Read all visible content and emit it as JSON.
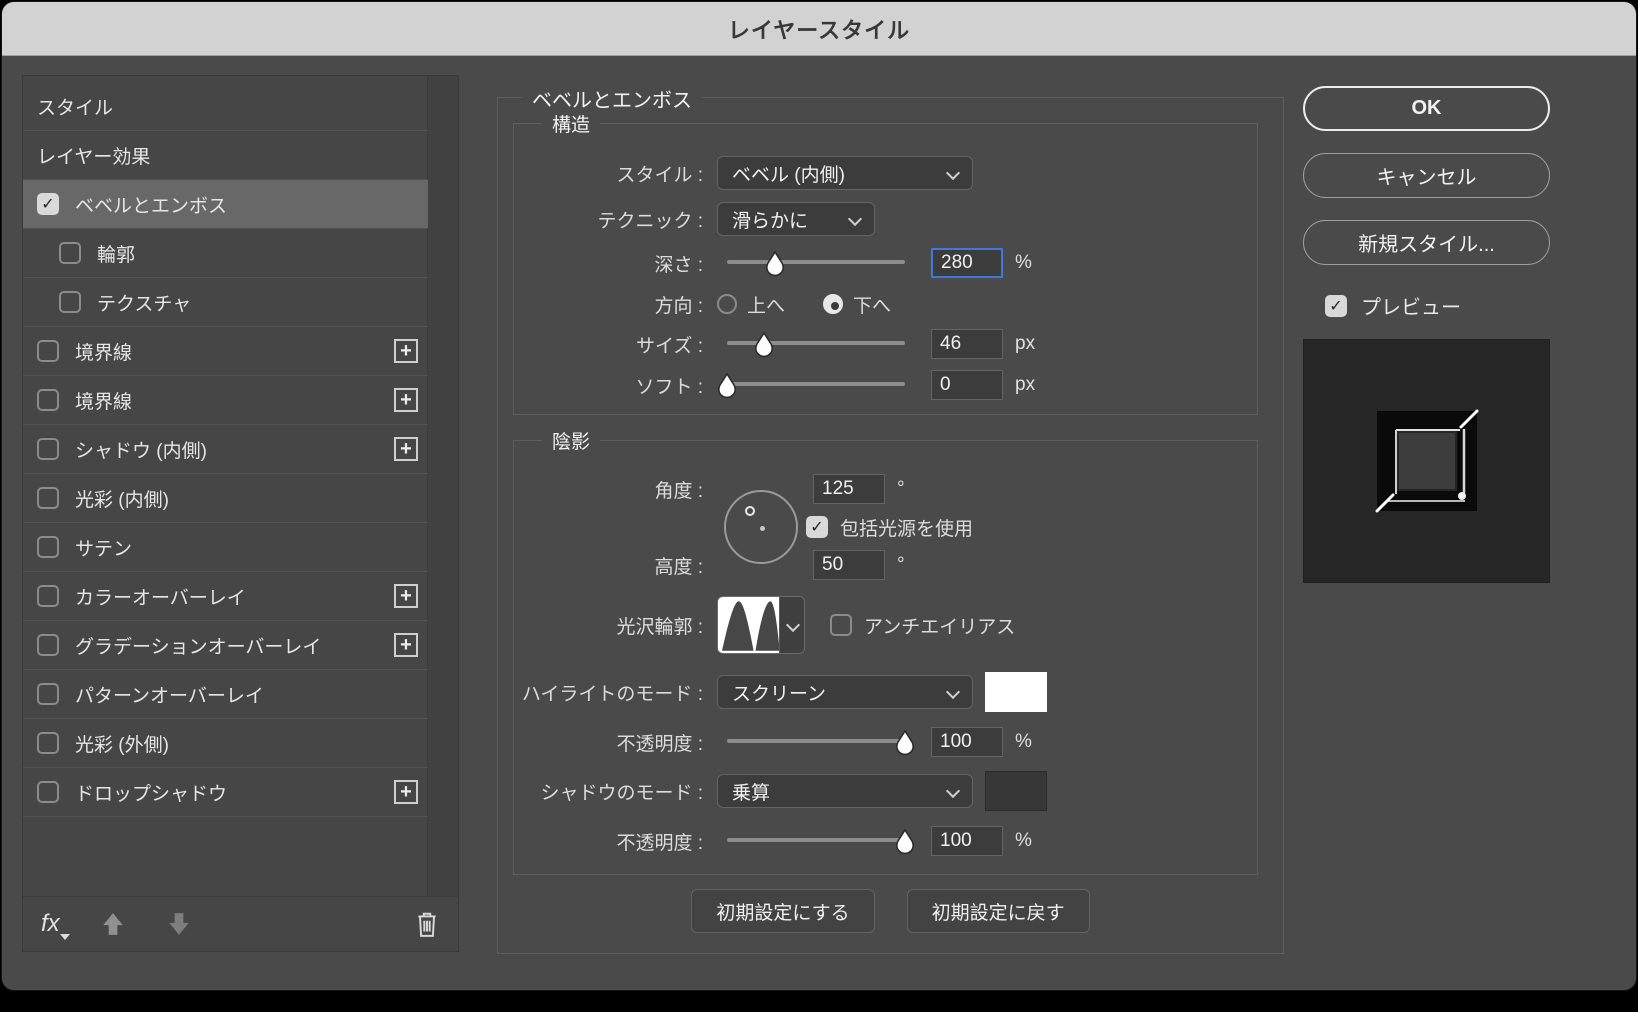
{
  "window": {
    "title": "レイヤースタイル"
  },
  "icons": {
    "check": "✓",
    "plus": "+",
    "fx": "fx"
  },
  "sidebar": {
    "items": [
      {
        "label": "スタイル",
        "checkbox": false,
        "checked": false,
        "plus": false,
        "selected": false,
        "indent": false
      },
      {
        "label": "レイヤー効果",
        "checkbox": false,
        "checked": false,
        "plus": false,
        "selected": false,
        "indent": false
      },
      {
        "label": "ベベルとエンボス",
        "checkbox": true,
        "checked": true,
        "plus": false,
        "selected": true,
        "indent": false
      },
      {
        "label": "輪郭",
        "checkbox": true,
        "checked": false,
        "plus": false,
        "selected": false,
        "indent": true
      },
      {
        "label": "テクスチャ",
        "checkbox": true,
        "checked": false,
        "plus": false,
        "selected": false,
        "indent": true
      },
      {
        "label": "境界線",
        "checkbox": true,
        "checked": false,
        "plus": true,
        "selected": false,
        "indent": false
      },
      {
        "label": "境界線",
        "checkbox": true,
        "checked": false,
        "plus": true,
        "selected": false,
        "indent": false
      },
      {
        "label": "シャドウ (内側)",
        "checkbox": true,
        "checked": false,
        "plus": true,
        "selected": false,
        "indent": false
      },
      {
        "label": "光彩 (内側)",
        "checkbox": true,
        "checked": false,
        "plus": false,
        "selected": false,
        "indent": false
      },
      {
        "label": "サテン",
        "checkbox": true,
        "checked": false,
        "plus": false,
        "selected": false,
        "indent": false
      },
      {
        "label": "カラーオーバーレイ",
        "checkbox": true,
        "checked": false,
        "plus": true,
        "selected": false,
        "indent": false
      },
      {
        "label": "グラデーションオーバーレイ",
        "checkbox": true,
        "checked": false,
        "plus": true,
        "selected": false,
        "indent": false
      },
      {
        "label": "パターンオーバーレイ",
        "checkbox": true,
        "checked": false,
        "plus": false,
        "selected": false,
        "indent": false
      },
      {
        "label": "光彩 (外側)",
        "checkbox": true,
        "checked": false,
        "plus": false,
        "selected": false,
        "indent": false
      },
      {
        "label": "ドロップシャドウ",
        "checkbox": true,
        "checked": false,
        "plus": true,
        "selected": false,
        "indent": false
      }
    ],
    "toolbar": {
      "fx_label": "fx"
    }
  },
  "panel": {
    "title": "ベベルとエンボス",
    "structure": {
      "legend": "構造",
      "style_label": "スタイル :",
      "style_value": "ベベル (内側)",
      "technique_label": "テクニック :",
      "technique_value": "滑らかに",
      "depth_label": "深さ :",
      "depth_value": "280",
      "depth_unit": "%",
      "depth_pct": 27,
      "direction_label": "方向 :",
      "direction_up": "上へ",
      "direction_down": "下へ",
      "size_label": "サイズ :",
      "size_value": "46",
      "size_unit": "px",
      "size_pct": 21,
      "soften_label": "ソフト :",
      "soften_value": "0",
      "soften_unit": "px",
      "soften_pct": 0
    },
    "shading": {
      "legend": "陰影",
      "angle_label": "角度 :",
      "angle_value": "125",
      "angle_unit": "°",
      "global_light_label": "包括光源を使用",
      "altitude_label": "高度 :",
      "altitude_value": "50",
      "altitude_unit": "°",
      "gloss_label": "光沢輪郭 :",
      "antialias_label": "アンチエイリアス",
      "highlight_label": "ハイライトのモード :",
      "highlight_value": "スクリーン",
      "highlight_color": "#ffffff",
      "opacity1_label": "不透明度 :",
      "opacity1_value": "100",
      "opacity1_unit": "%",
      "opacity1_pct": 100,
      "shadow_label": "シャドウのモード :",
      "shadow_value": "乗算",
      "shadow_color": "#373737",
      "opacity2_label": "不透明度 :",
      "opacity2_value": "100",
      "opacity2_unit": "%",
      "opacity2_pct": 100
    },
    "buttons": {
      "set_default": "初期設定にする",
      "reset_default": "初期設定に戻す"
    }
  },
  "actions": {
    "ok": "OK",
    "cancel": "キャンセル",
    "new_style": "新規スタイル...",
    "preview": "プレビュー"
  }
}
